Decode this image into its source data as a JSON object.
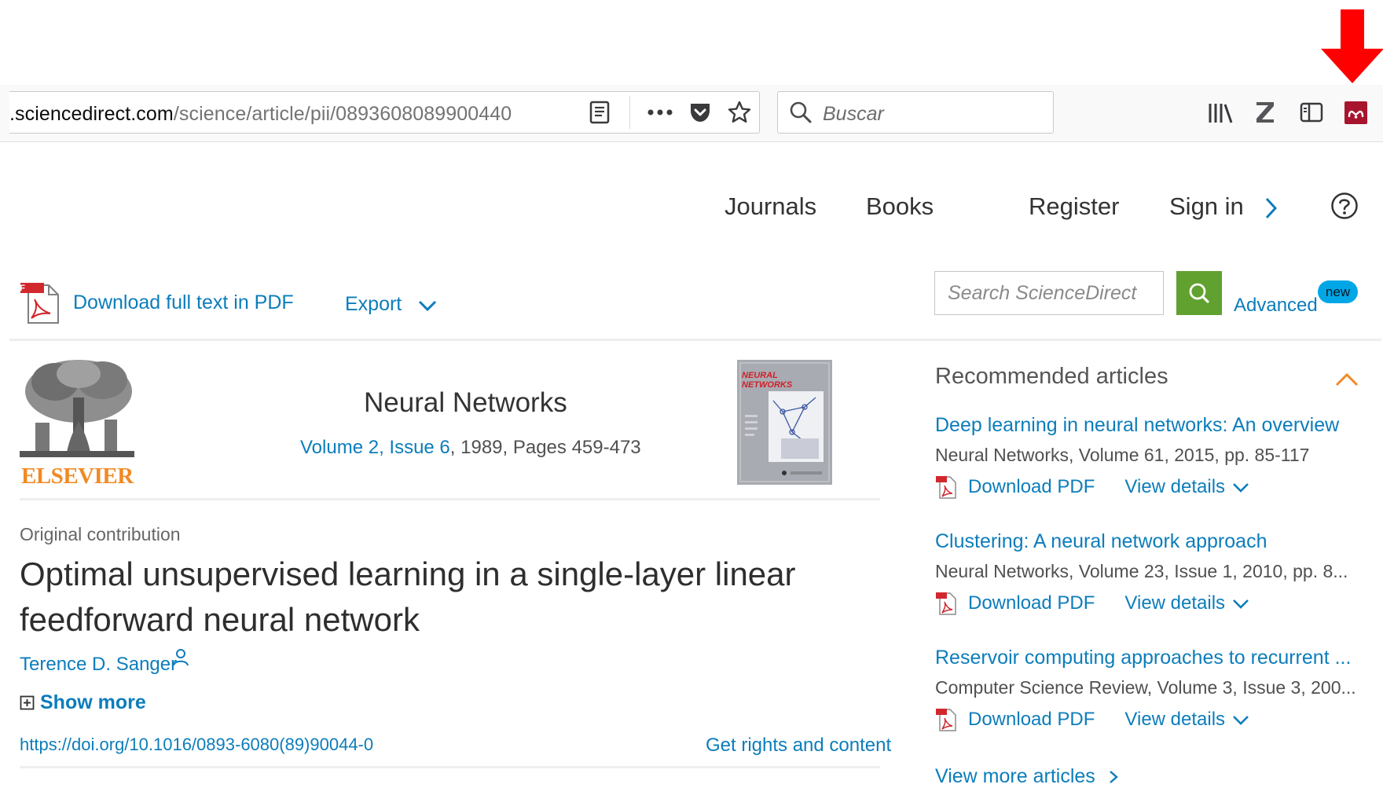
{
  "browser": {
    "url_domain": ".sciencedirect.com",
    "url_path": "/science/article/pii/0893608089900440",
    "search_placeholder": "Buscar",
    "icons": [
      "reader-view-icon",
      "more-actions-icon",
      "pocket-icon",
      "bookmark-star-icon",
      "search-icon",
      "library-icon",
      "zotero-icon",
      "sidebar-icon",
      "mendeley-extension-icon"
    ]
  },
  "annotation": {
    "arrow_color": "#ff0000"
  },
  "site_nav": {
    "journals": "Journals",
    "books": "Books",
    "register": "Register",
    "sign_in": "Sign in",
    "help_icon": "help-circle-icon"
  },
  "actions": {
    "download_pdf": "Download full text in PDF",
    "export": "Export",
    "pdf_label": "PDF"
  },
  "sd_search": {
    "placeholder": "Search ScienceDirect",
    "advanced": "Advanced",
    "new_badge": "new"
  },
  "journal": {
    "publisher": "ELSEVIER",
    "title": "Neural Networks",
    "volume_link": "Volume 2, Issue 6",
    "year_pages": ", 1989, Pages 459-473",
    "cover_text": "NEURAL NETWORKS"
  },
  "article": {
    "type": "Original contribution",
    "title": "Optimal unsupervised learning in a single-layer linear feedforward neural network",
    "author": "Terence D. Sanger",
    "show_more": "Show more",
    "doi": "https://doi.org/10.1016/0893-6080(89)90044-0",
    "rights": "Get rights and content"
  },
  "recommended": {
    "heading": "Recommended articles",
    "items": [
      {
        "title": "Deep learning in neural networks: An overview",
        "source": "Neural Networks, Volume 61, 2015, pp. 85-117",
        "download": "Download PDF",
        "details": "View details"
      },
      {
        "title": "Clustering: A neural network approach",
        "source": "Neural Networks, Volume 23, Issue 1, 2010, pp. 8...",
        "download": "Download PDF",
        "details": "View details"
      },
      {
        "title": "Reservoir computing approaches to recurrent ...",
        "source": "Computer Science Review, Volume 3, Issue 3, 200...",
        "download": "Download PDF",
        "details": "View details"
      }
    ],
    "view_more": "View more articles"
  },
  "colors": {
    "link": "#0c7dbb",
    "search_button": "#61a12f",
    "new_badge": "#00a6e6",
    "elsevier_orange": "#f08a24",
    "collapse_chevron": "#f08a24"
  }
}
